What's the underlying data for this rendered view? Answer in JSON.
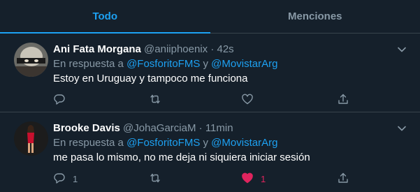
{
  "tabs": [
    {
      "label": "Todo",
      "active": true
    },
    {
      "label": "Menciones",
      "active": false
    }
  ],
  "reply_prefix": "En respuesta a",
  "reply_and": "y",
  "tweets": [
    {
      "name": "Ani Fata Morgana",
      "handle": "@aniiphoenix",
      "separator": "·",
      "time": "42s",
      "mention1": "@FosforitoFMS",
      "mention2": "@MovistarArg",
      "text": "Estoy en Uruguay y tampoco me funciona",
      "reply_count": "",
      "retweet_count": "",
      "like_count": "",
      "liked": false
    },
    {
      "name": "Brooke Davis",
      "handle": "@JohaGarciaM",
      "separator": "·",
      "time": "11min",
      "mention1": "@FosforitoFMS",
      "mention2": "@MovistarArg",
      "text": "me pasa lo mismo, no me deja ni siquiera iniciar sesión",
      "reply_count": "1",
      "retweet_count": "",
      "like_count": "1",
      "liked": true
    }
  ],
  "colors": {
    "background": "#15202b",
    "accent": "#1da1f2",
    "secondary_text": "#8899a6",
    "like": "#e0245e",
    "divider": "#38444d"
  },
  "icons": [
    "reply-icon",
    "retweet-icon",
    "like-icon",
    "share-icon",
    "chevron-down-icon"
  ]
}
